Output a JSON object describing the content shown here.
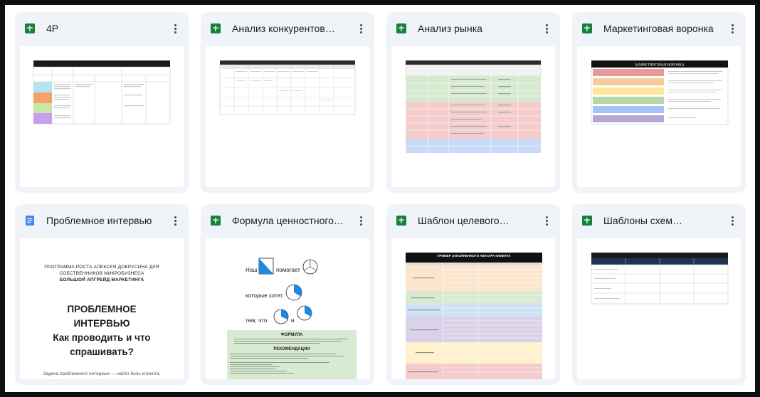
{
  "colors": {
    "card_bg": "#f0f4f9",
    "sheets_icon": "#188038",
    "docs_icon": "#4285f4"
  },
  "files": [
    {
      "title": "4P",
      "type": "sheets",
      "icon": "google-sheets-icon"
    },
    {
      "title": "Анализ конкурентов…",
      "type": "sheets",
      "icon": "google-sheets-icon"
    },
    {
      "title": "Анализ рынка",
      "type": "sheets",
      "icon": "google-sheets-icon"
    },
    {
      "title": "Маркетинговая воронка",
      "type": "sheets",
      "icon": "google-sheets-icon"
    },
    {
      "title": "Проблемное интервью",
      "type": "docs",
      "icon": "google-docs-icon"
    },
    {
      "title": "Формула ценностного…",
      "type": "sheets",
      "icon": "google-sheets-icon"
    },
    {
      "title": "Шаблон целевого…",
      "type": "sheets",
      "icon": "google-sheets-icon"
    },
    {
      "title": "Шаблоны схем…",
      "type": "sheets",
      "icon": "google-sheets-icon"
    }
  ],
  "previews": {
    "p4": {
      "title": "МОДЕЛЬ 4P"
    },
    "funnel": {
      "title": "МАРКЕТИНГОВАЯ ВОРОНКА"
    },
    "interview": {
      "program_line1": "ПРОГРАММА РОСТА АЛЕКСЕЯ ДОБРУСИНА ДЛЯ",
      "program_line2": "СОБСТВЕННИКОВ МИКРОБИЗНЕСА",
      "program_line3": "БОЛЬШОЙ АПГРЕЙД МАРКЕТИНГА",
      "heading_line1": "ПРОБЛЕМНОЕ",
      "heading_line2": "ИНТЕРВЬЮ",
      "heading_line3": "Как проводить и что",
      "heading_line4": "спрашивать?",
      "footer": "Задача проблемного интервью — найти боль клиента,"
    },
    "formula": {
      "line_nash": "Наш",
      "line_pomogaet": "помогает",
      "line_kotorye": "которые хотят",
      "line_tem": "тем, что",
      "line_i": "и",
      "formula_title": "ФОРМУЛА",
      "recommend_title": "РЕКОМЕНДАЦИИ"
    },
    "avatar": {
      "title": "ПРИМЕР ЗАПОЛНЕННОГО АВАТАРА КЛИЕНТА"
    }
  }
}
